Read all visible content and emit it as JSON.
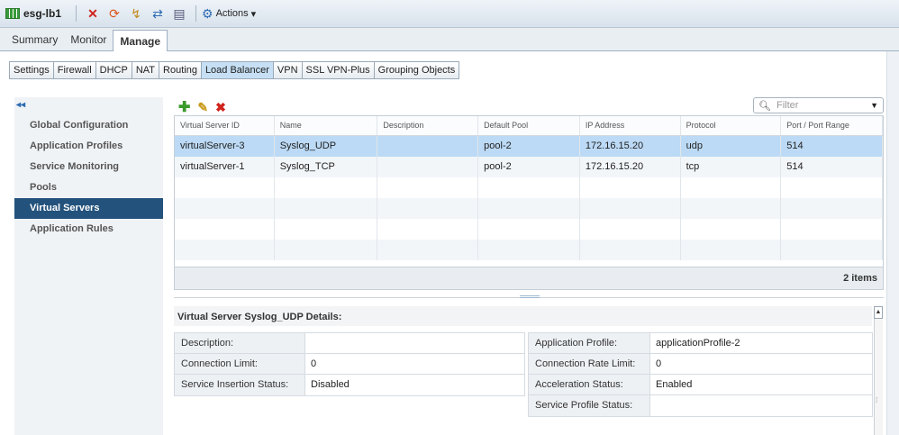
{
  "window": {
    "title": "esg-lb1"
  },
  "toolbar": {
    "actions_label": "Actions",
    "actions_arrow": "▾"
  },
  "main_tabs": [
    {
      "label": "Summary",
      "active": false
    },
    {
      "label": "Monitor",
      "active": false
    },
    {
      "label": "Manage",
      "active": true
    }
  ],
  "sub_tabs": [
    {
      "label": "Settings",
      "active": false
    },
    {
      "label": "Firewall",
      "active": false
    },
    {
      "label": "DHCP",
      "active": false
    },
    {
      "label": "NAT",
      "active": false
    },
    {
      "label": "Routing",
      "active": false
    },
    {
      "label": "Load Balancer",
      "active": true
    },
    {
      "label": "VPN",
      "active": false
    },
    {
      "label": "SSL VPN-Plus",
      "active": false
    },
    {
      "label": "Grouping Objects",
      "active": false
    }
  ],
  "sidebar": {
    "collapse_glyph": "◂◂",
    "items": [
      {
        "label": "Global Configuration",
        "active": false
      },
      {
        "label": "Application Profiles",
        "active": false
      },
      {
        "label": "Service Monitoring",
        "active": false
      },
      {
        "label": "Pools",
        "active": false
      },
      {
        "label": "Virtual Servers",
        "active": true
      },
      {
        "label": "Application Rules",
        "active": false
      }
    ]
  },
  "filter": {
    "placeholder": "Filter"
  },
  "grid": {
    "columns": [
      "Virtual Server ID",
      "Name",
      "Description",
      "Default Pool",
      "IP Address",
      "Protocol",
      "Port / Port Range"
    ],
    "rows": [
      {
        "selected": true,
        "cells": [
          "virtualServer-3",
          "Syslog_UDP",
          "",
          "pool-2",
          "172.16.15.20",
          "udp",
          "514"
        ]
      },
      {
        "selected": false,
        "cells": [
          "virtualServer-1",
          "Syslog_TCP",
          "",
          "pool-2",
          "172.16.15.20",
          "tcp",
          "514"
        ]
      }
    ],
    "footer": "2 items"
  },
  "details": {
    "title": "Virtual Server Syslog_UDP Details:",
    "left": [
      {
        "label": "Description:",
        "value": ""
      },
      {
        "label": "Connection Limit:",
        "value": "0"
      },
      {
        "label": "Service Insertion Status:",
        "value": "Disabled"
      }
    ],
    "right": [
      {
        "label": "Application Profile:",
        "value": "applicationProfile-2"
      },
      {
        "label": "Connection Rate Limit:",
        "value": "0"
      },
      {
        "label": "Acceleration Status:",
        "value": "Enabled"
      },
      {
        "label": "Service Profile Status:",
        "value": ""
      }
    ]
  },
  "colors": {
    "accent_selected_nav": "#23527c",
    "selected_row": "#bcdaf5",
    "add_icon": "#3a9a2a",
    "delete_icon": "#d0241c"
  }
}
